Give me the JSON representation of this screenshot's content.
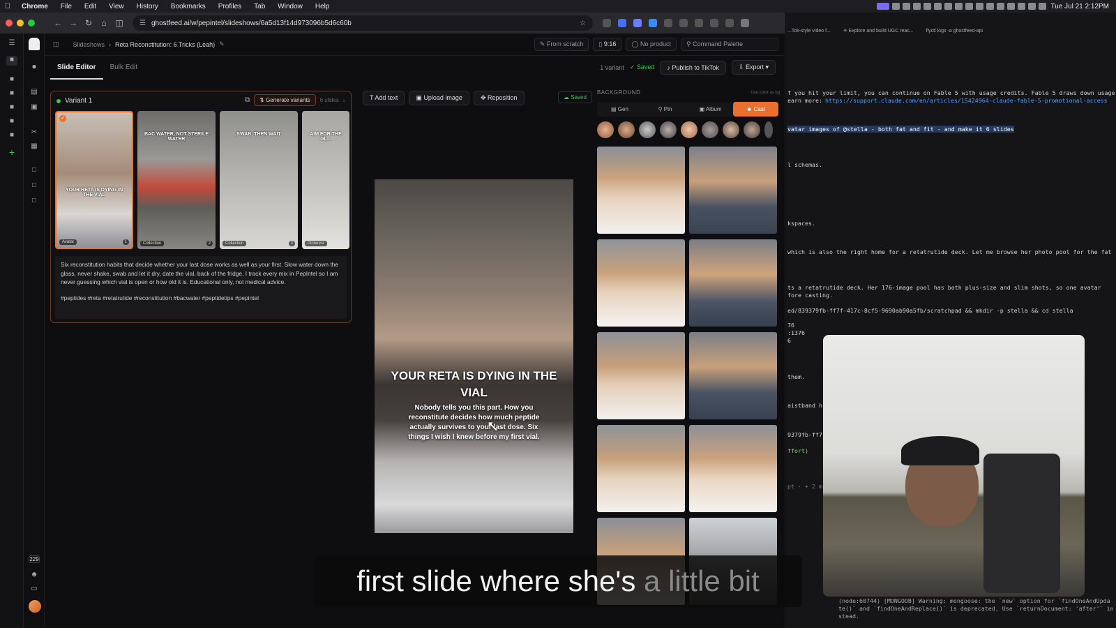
{
  "menubar": {
    "app": "Chrome",
    "items": [
      "File",
      "Edit",
      "View",
      "History",
      "Bookmarks",
      "Profiles",
      "Tab",
      "Window",
      "Help"
    ],
    "clock": "Tue Jul 21  2:12PM"
  },
  "browser": {
    "url": "ghostfeed.ai/w/pepintel/slideshows/6a5d13f14d973096b5d6c60b"
  },
  "app": {
    "breadcrumb": {
      "parent": "Slideshows",
      "current": "Reta Reconstitution: 6 Tricks (Leah)"
    },
    "header_tools": {
      "from_scratch": "From scratch",
      "ratio": "9:16",
      "product": "No product",
      "command": "Command Palette"
    },
    "tabs": [
      {
        "label": "Slide Editor",
        "active": true
      },
      {
        "label": "Bulk Edit",
        "active": false
      }
    ],
    "right_actions": {
      "variants": "1 variant",
      "saved": "Saved",
      "publish": "Publish to TikTok",
      "export": "Export"
    },
    "rail_badge": "229"
  },
  "variant": {
    "label": "Variant 1",
    "generate": "Generate variants",
    "slides_count": "6 slides",
    "thumbs": [
      {
        "title": "YOUR RETA IS DYING IN THE VIAL",
        "tag": "Avatar",
        "num": "1"
      },
      {
        "title": "BAC WATER, NOT STERILE WATER",
        "tag": "Collection",
        "num": "2"
      },
      {
        "title": "SWAB, THEN WAIT",
        "tag": "Collection",
        "num": "3"
      },
      {
        "title": "AIM FOR THE GL...",
        "tag": "Pinterest",
        "num": ""
      }
    ],
    "caption": "Six reconstitution habits that decide whether your last dose works as well as your first. Slow water down the glass, never shake, swab and let it dry, date the vial, back of the fridge. I track every mix in PepIntel so I am never guessing which vial is open or how old it is. Educational only, not medical advice.",
    "hashtags": "#peptides #reta #retatrutide #reconstitution #bacwater #peptidetips #pepintel"
  },
  "editor": {
    "tools": [
      "Add text",
      "Upload image",
      "Reposition"
    ],
    "saved": "Saved",
    "slide_title": "YOUR RETA IS DYING IN THE VIAL",
    "slide_body": "Nobody tells you this part. How you reconstitute decides how much peptide actually survives to your last dose. Six things I wish I knew before my first vial."
  },
  "background": {
    "label": "BACKGROUND",
    "hint": "Use color as bg",
    "segments": [
      "Gen",
      "Pin",
      "Album",
      "Cast"
    ],
    "active_segment": "Cast"
  },
  "terminal": {
    "tabs": [
      "...Tok-style video f...",
      "✳ Explore and build UGC reac...",
      "flyctl logs -a ghostfeed-api"
    ],
    "lines": [
      {
        "t": "f you hit your limit, you can continue on Fable 5 with usage credits. Fable 5 draws down usage",
        "c": ""
      },
      {
        "t": "earn more: ",
        "c": ""
      },
      {
        "t": "https://support.claude.com/en/articles/15424964-claude-fable-5-promotional-access",
        "c": "link"
      },
      {
        "t": "vatar images of @stella - both fat and fit - and make it 6 slides",
        "c": "hl"
      },
      {
        "t": "l schemas.",
        "c": ""
      },
      {
        "t": "kspaces.",
        "c": ""
      },
      {
        "t": " which is also the right home for a retatrutide deck. Let me browse her photo pool for the fat",
        "c": ""
      },
      {
        "t": "ts a retatrutide deck. Her 176-image pool has both plus-size and slim shots, so one avatar",
        "c": ""
      },
      {
        "t": "fore casting.",
        "c": ""
      },
      {
        "t": "ed/839379fb-ff7f-417c-8cf5-9690ab90a5fb/scratchpad && mkdir -p stella && cd stella",
        "c": ""
      },
      {
        "t": "76",
        "c": ""
      },
      {
        "t": ":1376",
        "c": ""
      },
      {
        "t": "6",
        "c": ""
      },
      {
        "t": "them.",
        "c": ""
      },
      {
        "t": "aistband h",
        "c": ""
      },
      {
        "t": "9379fb-ff7",
        "c": ""
      },
      {
        "t": "ffort)",
        "c": "grn"
      },
      {
        "t": "pt · + 2 m",
        "c": ""
      },
      {
        "t": "(node:60744) [MONGODB] Warning: mongoose: the `new` option for `findOneAndUpda",
        "c": ""
      },
      {
        "t": "te()` and `findOneAndReplace()` is deprecated. Use `returnDocument: 'after'` in",
        "c": ""
      },
      {
        "t": "stead.",
        "c": ""
      }
    ]
  },
  "subtitle": {
    "main": "first slide where she's ",
    "dim": "a little bit"
  }
}
